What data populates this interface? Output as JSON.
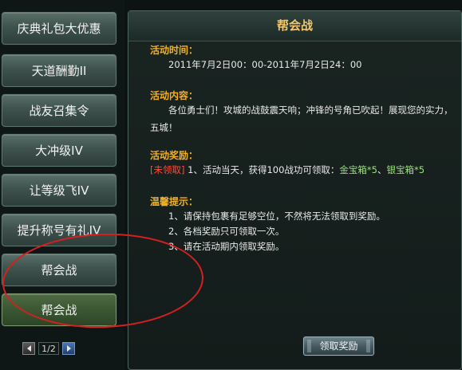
{
  "menu": [
    {
      "label": "庆典礼包大优惠",
      "selected": false
    },
    {
      "label": "天道酬勤II",
      "selected": false
    },
    {
      "label": "战友召集令",
      "selected": false
    },
    {
      "label": "大冲级IV",
      "selected": false
    },
    {
      "label": "让等级飞IV",
      "selected": false
    },
    {
      "label": "提升称号有礼IV",
      "selected": false
    },
    {
      "label": "帮会战",
      "selected": false
    },
    {
      "label": "帮会战",
      "selected": true
    }
  ],
  "pager": {
    "page_text": "1/2",
    "prev_icon": "arrow-left-icon",
    "next_icon": "arrow-right-icon"
  },
  "panel": {
    "title": "帮会战",
    "sections": {
      "time": {
        "heading": "活动时间：",
        "text": "2011年7月2日00：00-2011年7月2日24：00"
      },
      "content": {
        "heading": "活动内容：",
        "line1": "各位勇士们！攻城的战鼓震天响；冲锋的号角已吹起！展现您的实力，",
        "line2": "五城！"
      },
      "reward": {
        "heading": "活动奖励：",
        "status": "[未领取]",
        "text": " 1、活动当天，获得100战功可领取：",
        "item1": "金宝箱*5",
        "sep": "、",
        "item2": "银宝箱*5"
      },
      "tips": {
        "heading": "温馨提示：",
        "items": [
          "1、请保持包裹有足够空位，不然将无法领取到奖励。",
          "2、各档奖励只可领取一次。",
          "3、请在活动期内领取奖励。"
        ]
      }
    },
    "claim_button": "领取奖励"
  },
  "colors": {
    "heading": "#f2b021",
    "title": "#f2c66d",
    "status_unclaimed": "#ff4b3c",
    "reward_item": "#9be27c",
    "annotation": "#d61f1f"
  }
}
